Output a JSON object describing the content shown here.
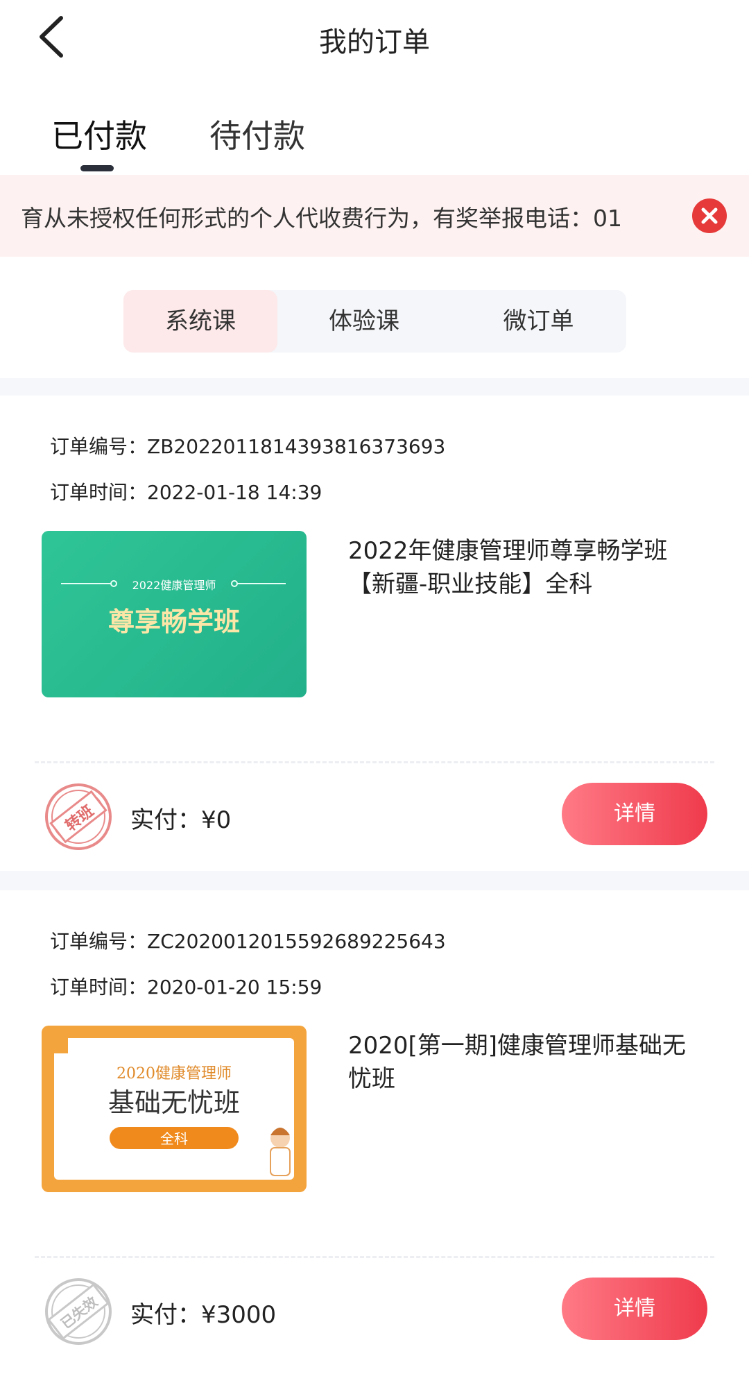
{
  "header": {
    "title": "我的订单"
  },
  "tabs": [
    {
      "label": "已付款"
    },
    {
      "label": "待付款"
    }
  ],
  "notice": {
    "text": "育从未授权任何形式的个人代收费行为，有奖举报电话：01"
  },
  "segments": [
    {
      "label": "系统课"
    },
    {
      "label": "体验课"
    },
    {
      "label": "微订单"
    }
  ],
  "orders": [
    {
      "number_label": "订单编号：",
      "number": "ZB2022011814393816373693",
      "time_label": "订单时间：",
      "time": "2022-01-18 14:39",
      "thumb_caption": "2022健康管理师",
      "thumb_title": "尊享畅学班",
      "title": "2022年健康管理师尊享畅学班【新疆-职业技能】全科",
      "pay_label": "实付：",
      "pay_amount": "¥0",
      "stamp": "转班",
      "button": "详情"
    },
    {
      "number_label": "订单编号：",
      "number": "ZC2020012015592689225643",
      "time_label": "订单时间：",
      "time": "2020-01-20 15:59",
      "thumb_caption": "2020健康管理师",
      "thumb_title": "基础无忧班",
      "thumb_tag": "全科",
      "title": "2020[第一期]健康管理师基础无忧班",
      "pay_label": "实付：",
      "pay_amount": "¥3000",
      "stamp": "已失效",
      "button": "详情"
    }
  ]
}
